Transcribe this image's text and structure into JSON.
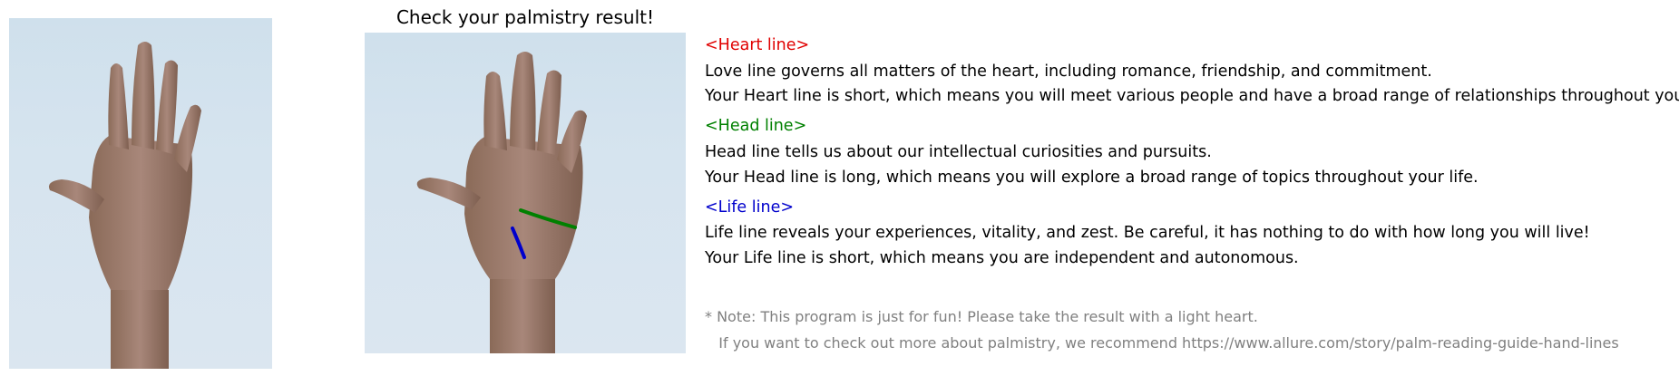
{
  "title": "Check your palmistry result!",
  "colors": {
    "heart": "#e00000",
    "head": "#008000",
    "life": "#0000cc",
    "note": "#808080"
  },
  "results": {
    "heart": {
      "header": "<Heart line>",
      "description": "Love line governs all matters of the heart, including romance, friendship, and commitment.",
      "verdict": "Your Heart line is short, which means you will meet various people and have a broad range of relationships throughout your life."
    },
    "head": {
      "header": "<Head line>",
      "description": "Head line tells us about our intellectual curiosities and pursuits.",
      "verdict": "Your Head line is long, which means you will explore a broad range of topics throughout your life."
    },
    "life": {
      "header": "<Life line>",
      "description": "Life line reveals your experiences, vitality, and zest. Be careful, it has nothing to do with how long you will live!",
      "verdict": "Your Life line is short, which means you are independent and autonomous."
    }
  },
  "note": {
    "line1": "* Note: This program is just for fun! Please take the result with a light heart.",
    "line2": "   If you want to check out more about palmistry, we recommend https://www.allure.com/story/palm-reading-guide-hand-lines"
  }
}
